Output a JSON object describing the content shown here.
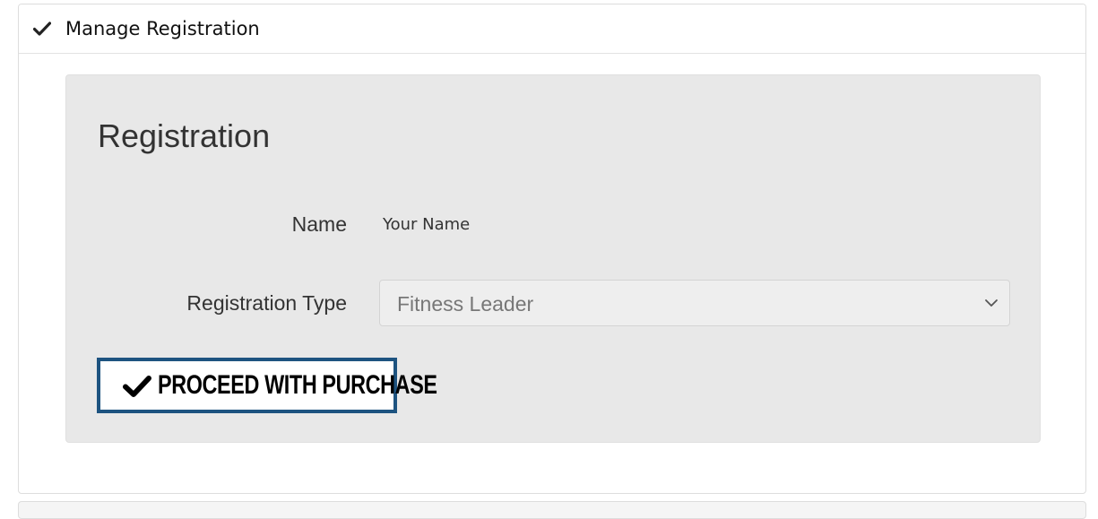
{
  "accordion": {
    "title": "Manage Registration",
    "expanded_icon": "check-icon"
  },
  "registration": {
    "heading": "Registration",
    "name_label": "Name",
    "name_value": "Your Name",
    "type_label": "Registration Type",
    "type_selected": "Fitness Leader",
    "proceed_label": "PROCEED WITH PURCHASE",
    "proceed_icon": "check-icon"
  },
  "colors": {
    "button_border": "#1d5380",
    "well_background": "#e8e8e8",
    "select_background": "#eeeeee"
  }
}
